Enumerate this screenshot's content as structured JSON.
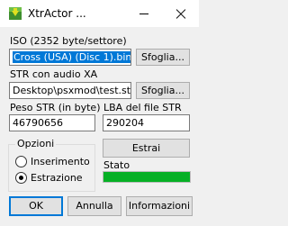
{
  "window": {
    "title": "XtrActor ..."
  },
  "iso": {
    "label": "ISO (2352 byte/settore)",
    "value": "Cross (USA) (Disc 1).bin",
    "browse_label": "Sfoglia..."
  },
  "str": {
    "label": "STR con audio XA",
    "value": "Desktop\\psxmod\\test.str",
    "browse_label": "Sfoglia..."
  },
  "peso": {
    "label": "Peso STR (in byte)",
    "value": "46790656"
  },
  "lba": {
    "label": "LBA del file STR",
    "value": "290204"
  },
  "options": {
    "title": "Opzioni",
    "items": [
      {
        "label": "Inserimento",
        "selected": false
      },
      {
        "label": "Estrazione",
        "selected": true
      }
    ]
  },
  "extract_button": "Estrai",
  "status": {
    "label": "Stato",
    "progress": 1.0,
    "color": "#06b025"
  },
  "footer": {
    "ok": "OK",
    "cancel": "Annulla",
    "info": "Informazioni"
  },
  "icons": {
    "app": "xtractor-app-icon",
    "minimize": "minimize-icon",
    "close": "close-icon"
  }
}
